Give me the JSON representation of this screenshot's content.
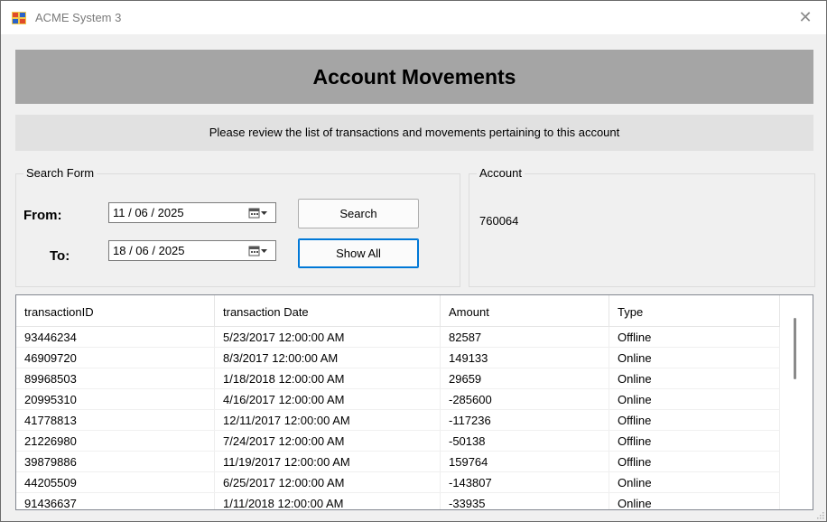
{
  "window": {
    "title": "ACME System 3",
    "close_glyph": "✕",
    "icon": "app-window-icon"
  },
  "header": {
    "title": "Account Movements",
    "subtitle": "Please review the list of transactions and movements pertaining to this account"
  },
  "search_form": {
    "title": "Search Form",
    "from_label": "From:",
    "to_label": "To:",
    "from_date": "11 / 06 / 2025",
    "to_date": "18 / 06 / 2025",
    "search_label": "Search",
    "show_all_label": "Show All"
  },
  "account": {
    "title": "Account",
    "value": "760064"
  },
  "grid": {
    "columns": [
      "transactionID",
      "transaction Date",
      "Amount",
      "Type"
    ],
    "rows": [
      [
        "93446234",
        "5/23/2017 12:00:00 AM",
        "82587",
        "Offline"
      ],
      [
        "46909720",
        "8/3/2017 12:00:00 AM",
        "149133",
        "Online"
      ],
      [
        "89968503",
        "1/18/2018 12:00:00 AM",
        "29659",
        "Online"
      ],
      [
        "20995310",
        "4/16/2017 12:00:00 AM",
        "-285600",
        "Online"
      ],
      [
        "41778813",
        "12/11/2017 12:00:00 AM",
        "-117236",
        "Offline"
      ],
      [
        "21226980",
        "7/24/2017 12:00:00 AM",
        "-50138",
        "Offline"
      ],
      [
        "39879886",
        "11/19/2017 12:00:00 AM",
        "159764",
        "Offline"
      ],
      [
        "44205509",
        "6/25/2017 12:00:00 AM",
        "-143807",
        "Online"
      ],
      [
        "91436637",
        "1/11/2018 12:00:00 AM",
        "-33935",
        "Online"
      ]
    ]
  },
  "colors": {
    "banner": "#a5a5a5",
    "subtitle_bg": "#e1e1e1",
    "focus_border": "#0078d7"
  }
}
